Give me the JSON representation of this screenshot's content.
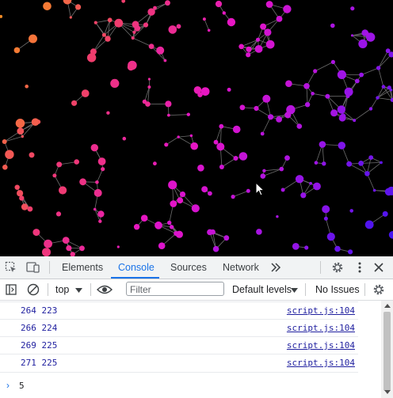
{
  "devtools": {
    "tabs": [
      {
        "label": "Elements",
        "active": false
      },
      {
        "label": "Console",
        "active": true
      },
      {
        "label": "Sources",
        "active": false
      },
      {
        "label": "Network",
        "active": false
      }
    ],
    "toolbar": {
      "context": "top",
      "filter_placeholder": "Filter",
      "levels": "Default levels",
      "issues": "No Issues"
    },
    "console": {
      "logs": [
        {
          "message": "264 223",
          "source": "script.js:104"
        },
        {
          "message": "266 224",
          "source": "script.js:104"
        },
        {
          "message": "269 225",
          "source": "script.js:104"
        },
        {
          "message": "271 225",
          "source": "script.js:104"
        }
      ],
      "prompt_input": "5"
    },
    "colors": {
      "accent": "#1a73e8",
      "log_text": "#1f1f9f",
      "canvas_bg": "#000000"
    }
  },
  "icons": [
    "inspect-icon",
    "device-toolbar-icon",
    "more-tabs-icon",
    "settings-icon",
    "kebab-menu-icon",
    "close-icon",
    "sidebar-toggle-icon",
    "clear-console-icon",
    "eye-icon",
    "dropdown-arrow-icon",
    "console-settings-icon",
    "prompt-chevron-icon",
    "mouse-cursor-icon"
  ]
}
